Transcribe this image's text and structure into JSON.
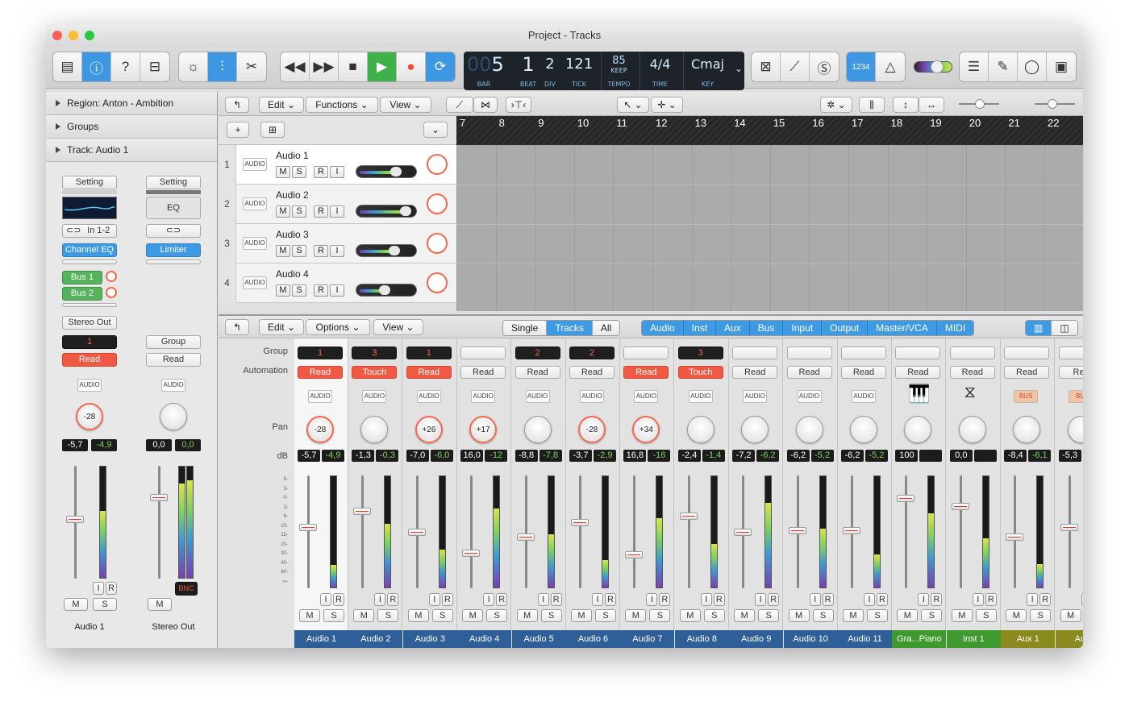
{
  "window": {
    "title": "Project - Tracks"
  },
  "toolbar": {
    "lcd": {
      "bar": "5",
      "beat": "1",
      "div": "2",
      "tick": "121",
      "tempo": "85",
      "tempo_mode": "KEEP",
      "sig": "4/4",
      "key": "Cmaj",
      "labels": {
        "bar": "BAR",
        "beat": "BEAT",
        "div": "DIV",
        "tick": "TICK",
        "tempo": "TEMPO",
        "time": "TIME",
        "key": "KEY"
      },
      "ghost": "00"
    },
    "count_in": "1234"
  },
  "inspector": {
    "region": "Region: Anton - Ambition",
    "groups": "Groups",
    "track": "Track:  Audio 1",
    "strip1": {
      "setting": "Setting",
      "input": "In 1-2",
      "plugin": "Channel EQ",
      "sends": [
        "Bus 1",
        "Bus 2"
      ],
      "output": "Stereo Out",
      "group": "1",
      "automation": "Read",
      "icon": "AUDIO",
      "pan": "-28",
      "db": "-5,7",
      "peak": "-4,9",
      "name": "Audio 1",
      "m": "M",
      "s": "S",
      "i": "I",
      "r": "R"
    },
    "strip2": {
      "setting": "Setting",
      "eq": "EQ",
      "plugin": "Limiter",
      "group": "Group",
      "automation": "Read",
      "icon": "AUDIO",
      "db": "0,0",
      "peak": "0,0",
      "bnc": "BNC",
      "name": "Stereo Out",
      "m": "M"
    }
  },
  "tracks_bar": {
    "edit": "Edit",
    "functions": "Functions",
    "view": "View"
  },
  "ruler": [
    "7",
    "8",
    "9",
    "10",
    "11",
    "12",
    "13",
    "14",
    "15",
    "16",
    "17",
    "18",
    "19",
    "20",
    "21",
    "22"
  ],
  "tracks": [
    {
      "num": "1",
      "name": "Audio 1",
      "icon": "AUDIO",
      "m": "M",
      "s": "S",
      "r": "R",
      "i": "I"
    },
    {
      "num": "2",
      "name": "Audio 2",
      "icon": "AUDIO",
      "m": "M",
      "s": "S",
      "r": "R",
      "i": "I"
    },
    {
      "num": "3",
      "name": "Audio 3",
      "icon": "AUDIO",
      "m": "M",
      "s": "S",
      "r": "R",
      "i": "I"
    },
    {
      "num": "4",
      "name": "Audio 4",
      "icon": "AUDIO",
      "m": "M",
      "s": "S",
      "r": "R",
      "i": "I"
    }
  ],
  "mixer_bar": {
    "edit": "Edit",
    "options": "Options",
    "view": "View",
    "modes": [
      "Single",
      "Tracks",
      "All"
    ],
    "filters": [
      "Audio",
      "Inst",
      "Aux",
      "Bus",
      "Input",
      "Output",
      "Master/VCA",
      "MIDI"
    ]
  },
  "mixer_labels": {
    "group": "Group",
    "automation": "Automation",
    "pan": "Pan",
    "db": "dB"
  },
  "scale": [
    "6-",
    "3-",
    "0-",
    "3-",
    "6-",
    "10-",
    "15-",
    "20-",
    "30-",
    "40-",
    "60-",
    "∞-"
  ],
  "channels": [
    {
      "name": "Audio 1",
      "group": "1",
      "auto": "Read",
      "autoColor": "red",
      "icon": "AUDIO",
      "pan": "-28",
      "db": "-5,7",
      "peak": "-4,9",
      "color": "#2f5f99"
    },
    {
      "name": "Audio 2",
      "group": "3",
      "auto": "Touch",
      "autoColor": "red",
      "icon": "AUDIO",
      "pan": "",
      "db": "-1,3",
      "peak": "-0,3",
      "color": "#2f5f99"
    },
    {
      "name": "Audio 3",
      "group": "1",
      "auto": "Read",
      "autoColor": "red",
      "icon": "AUDIO",
      "pan": "+26",
      "db": "-7,0",
      "peak": "-6,0",
      "color": "#2f5f99"
    },
    {
      "name": "Audio 4",
      "group": "",
      "auto": "Read",
      "autoColor": "white",
      "icon": "AUDIO",
      "pan": "+17",
      "db": "16,0",
      "peak": "-12",
      "color": "#2f5f99"
    },
    {
      "name": "Audio 5",
      "group": "2",
      "auto": "Read",
      "autoColor": "white",
      "icon": "AUDIO",
      "pan": "",
      "db": "-8,8",
      "peak": "-7,8",
      "color": "#2f5f99"
    },
    {
      "name": "Audio 6",
      "group": "2",
      "auto": "Read",
      "autoColor": "white",
      "icon": "AUDIO",
      "pan": "-28",
      "db": "-3,7",
      "peak": "-2,9",
      "color": "#2f5f99"
    },
    {
      "name": "Audio 7",
      "group": "",
      "auto": "Read",
      "autoColor": "red",
      "icon": "AUDIO",
      "pan": "+34",
      "db": "16,8",
      "peak": "-16",
      "color": "#2f5f99"
    },
    {
      "name": "Audio 8",
      "group": "3",
      "auto": "Touch",
      "autoColor": "red",
      "icon": "AUDIO",
      "pan": "",
      "db": "-2,4",
      "peak": "-1,4",
      "color": "#2f5f99"
    },
    {
      "name": "Audio 9",
      "group": "",
      "auto": "Read",
      "autoColor": "white",
      "icon": "AUDIO",
      "pan": "",
      "db": "-7,2",
      "peak": "-6,2",
      "color": "#2f5f99"
    },
    {
      "name": "Audio 10",
      "group": "",
      "auto": "Read",
      "autoColor": "white",
      "icon": "AUDIO",
      "pan": "",
      "db": "-6,2",
      "peak": "-5,2",
      "color": "#2f5f99"
    },
    {
      "name": "Audio 11",
      "group": "",
      "auto": "Read",
      "autoColor": "white",
      "icon": "AUDIO",
      "pan": "",
      "db": "-6,2",
      "peak": "-5,2",
      "color": "#2f5f99"
    },
    {
      "name": "Gra...Piano",
      "group": "",
      "auto": "Read",
      "autoColor": "white",
      "icon": "piano",
      "pan": "",
      "db": "100",
      "peak": "",
      "color": "#3e9a2e"
    },
    {
      "name": "Inst 1",
      "group": "",
      "auto": "Read",
      "autoColor": "white",
      "icon": "metronome",
      "pan": "",
      "db": "0,0",
      "peak": "",
      "color": "#3e9a2e"
    },
    {
      "name": "Aux 1",
      "group": "",
      "auto": "Read",
      "autoColor": "white",
      "icon": "BUS",
      "pan": "",
      "db": "-8,4",
      "peak": "-6,1",
      "color": "#8a8a1f"
    },
    {
      "name": "Aux",
      "group": "",
      "auto": "Rea",
      "autoColor": "white",
      "icon": "BU",
      "pan": "",
      "db": "-5,3",
      "peak": "",
      "color": "#8a8a1f"
    }
  ],
  "strip_buttons": {
    "m": "M",
    "s": "S",
    "i": "I",
    "r": "R"
  }
}
